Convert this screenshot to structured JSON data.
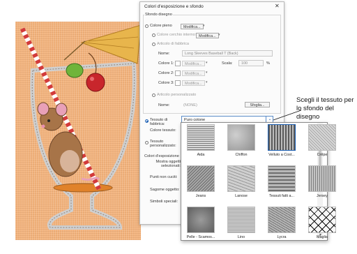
{
  "dialog": {
    "title": "Colori d'esposizione e sfondo",
    "close_glyph": "✕",
    "section_design_bg": "Sfondo disegno",
    "opt_plain_color": "Colore pieno",
    "modify_label": "Modifica...",
    "opt_inner_color": "Colore cerchio interno:",
    "opt_fabric_article": "Articolo di fabbrica",
    "name_label": "Nome:",
    "name_value": "Long Sleeves Baseball T (Back)",
    "color1_label": "Colore 1:",
    "color2_label": "Colore 2:",
    "color3_label": "Colore 3:",
    "scale_label": "Scala:",
    "scale_value": "100",
    "scale_unit": "%",
    "opt_custom_article": "Articolo personalizzato",
    "custom_name_label": "Nome:",
    "custom_name_value": "(NONE)",
    "browse_label": "Sfoglia...",
    "opt_fabric": "Tessuto di fabbrica:",
    "fabric_selected": "Puro cotone",
    "fabric_color_label": "Colore tessuto:",
    "opt_custom_fabric": "Tessuto personalizzato:",
    "exposure_colors_label": "Colori d'esposizione",
    "show_selected_label": "Mostra oggetti selezionati:",
    "stitch_points_label": "Punti non cuciti:",
    "selection_outline_label": "Sagome oggetto:",
    "special_symbols_label": "Simboli speciali:"
  },
  "fabric_options": [
    {
      "label": "Aida",
      "texture": "aida"
    },
    {
      "label": "Chiffon",
      "texture": "chiffon"
    },
    {
      "label": "Velluto a Cost...",
      "texture": "corduroy"
    },
    {
      "label": "Crêpe",
      "texture": "crepe"
    },
    {
      "label": "Jeans",
      "texture": "jeans"
    },
    {
      "label": "Lanose",
      "texture": "wool"
    },
    {
      "label": "Tessuti fatti a...",
      "texture": "knit"
    },
    {
      "label": "Jersey",
      "texture": "jersey"
    },
    {
      "label": "Pelle - Scamos...",
      "texture": "suede"
    },
    {
      "label": "Lino",
      "texture": "linen"
    },
    {
      "label": "Lycra",
      "texture": "lycra"
    },
    {
      "label": "Maglia",
      "texture": "mesh"
    }
  ],
  "callout": {
    "text": "Scegli il tessuto per lo sfondo del disegno"
  },
  "colors": {
    "background_fabric": "#f2b37d",
    "accent": "#1a5fb4"
  }
}
